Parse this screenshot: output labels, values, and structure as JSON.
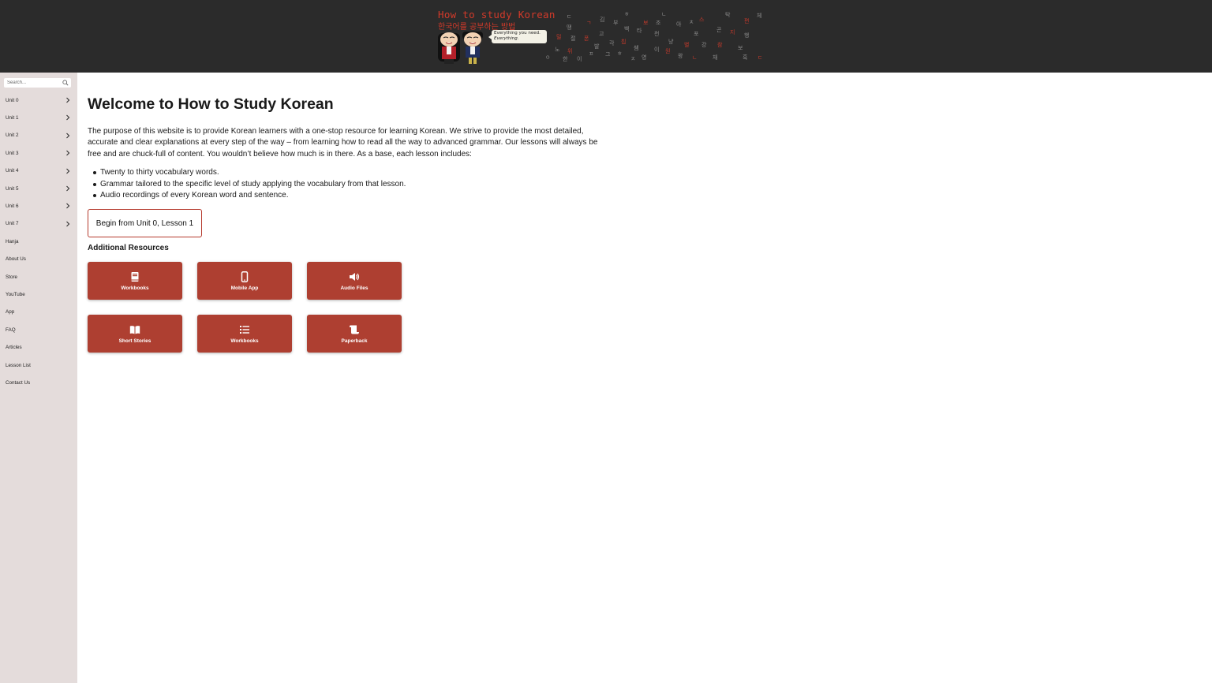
{
  "header": {
    "brand_en": "How to study Korean",
    "brand_ko": "한국어를 공부하는 방법",
    "speech_line1": "Everything you need.",
    "speech_line2": "Everything.",
    "accent_color": "#d23a2a",
    "background_color": "#2b2b2b"
  },
  "sidebar": {
    "search_placeholder": "Search...",
    "items": [
      {
        "label": "Unit 0",
        "expandable": true
      },
      {
        "label": "Unit 1",
        "expandable": true
      },
      {
        "label": "Unit 2",
        "expandable": true
      },
      {
        "label": "Unit 3",
        "expandable": true
      },
      {
        "label": "Unit 4",
        "expandable": true
      },
      {
        "label": "Unit 5",
        "expandable": true
      },
      {
        "label": "Unit 6",
        "expandable": true
      },
      {
        "label": "Unit 7",
        "expandable": true
      },
      {
        "label": "Hanja",
        "expandable": false
      },
      {
        "label": "About Us",
        "expandable": false
      },
      {
        "label": "Store",
        "expandable": false
      },
      {
        "label": "YouTube",
        "expandable": false
      },
      {
        "label": "App",
        "expandable": false
      },
      {
        "label": "FAQ",
        "expandable": false
      },
      {
        "label": "Articles",
        "expandable": false
      },
      {
        "label": "Lesson List",
        "expandable": false
      },
      {
        "label": "Contact Us",
        "expandable": false
      }
    ],
    "background_color": "#e4dcdb"
  },
  "main": {
    "title": "Welcome to How to Study Korean",
    "intro": "The purpose of this website is to provide Korean learners with a one-stop resource for learning Korean. We strive to provide the most detailed, accurate and clear explanations at every step of the way – from learning how to read all the way to advanced grammar. Our lessons will always be free and are chuck-full of content. You wouldn’t believe how much is in there. As a base, each lesson includes:",
    "bullets": [
      "Twenty to thirty vocabulary words.",
      "Grammar tailored to the specific level of study applying the vocabulary from that lesson.",
      "Audio recordings of every Korean word and sentence."
    ],
    "begin_button": "Begin from Unit 0, Lesson 1",
    "resources_heading": "Additional Resources",
    "resources": [
      {
        "label": "Workbooks",
        "icon": "book-icon"
      },
      {
        "label": "Mobile App",
        "icon": "mobile-phone-icon"
      },
      {
        "label": "Audio Files",
        "icon": "speaker-icon"
      },
      {
        "label": "Short Stories",
        "icon": "open-book-icon"
      },
      {
        "label": "Workbooks",
        "icon": "list-icon"
      },
      {
        "label": "Paperback",
        "icon": "scroll-icon"
      }
    ],
    "button_color": "#ae3f31"
  }
}
